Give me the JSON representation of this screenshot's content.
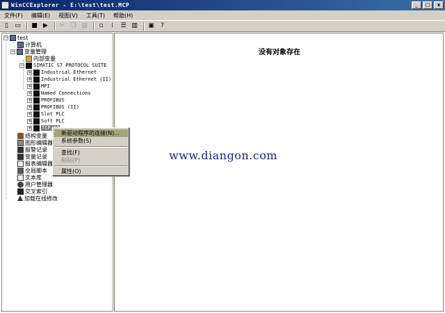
{
  "window": {
    "title": "WinCCExplorer - E:\\test\\test.MCP",
    "minimize": "_",
    "maximize": "□",
    "close": "x"
  },
  "menu": [
    "文件(F)",
    "编辑(E)",
    "视图(V)",
    "工具(T)",
    "帮助(H)"
  ],
  "toolbar": {
    "icons": [
      "new-icon",
      "open-icon",
      "stop-icon",
      "run-icon",
      "cut-icon",
      "copy-icon",
      "paste-icon",
      "small-icons-icon",
      "large-icons-icon",
      "list-icon",
      "details-icon",
      "properties-icon",
      "help-icon"
    ]
  },
  "tree": {
    "root": "test",
    "computer": "计算机",
    "tag_management": "变量管理",
    "internal_tags": "内部变量",
    "driver": "SIMATIC S7 PROTOCOL SUITE",
    "channel_units": [
      "Industrial Ethernet",
      "Industrial Ethernet (II)",
      "MPI",
      "Named Connections",
      "PROFIBUS",
      "PROFIBUS (II)",
      "Slot PLC",
      "Soft PLC",
      "TCP/IP"
    ],
    "items_after": [
      "结构变量",
      "图形编辑器",
      "报警记录",
      "变量记录",
      "报表编辑器",
      "全局脚本",
      "文本库",
      "用户管理器",
      "交叉索引",
      "加载在线修改"
    ]
  },
  "content": {
    "empty_message": "没有对象存在"
  },
  "context_menu": {
    "items": [
      "新驱动程序的连接(N)...",
      "系统参数(S)",
      "查找(F)",
      "粘贴(P)",
      "属性(O)"
    ]
  },
  "watermark": "www.diangon.com"
}
